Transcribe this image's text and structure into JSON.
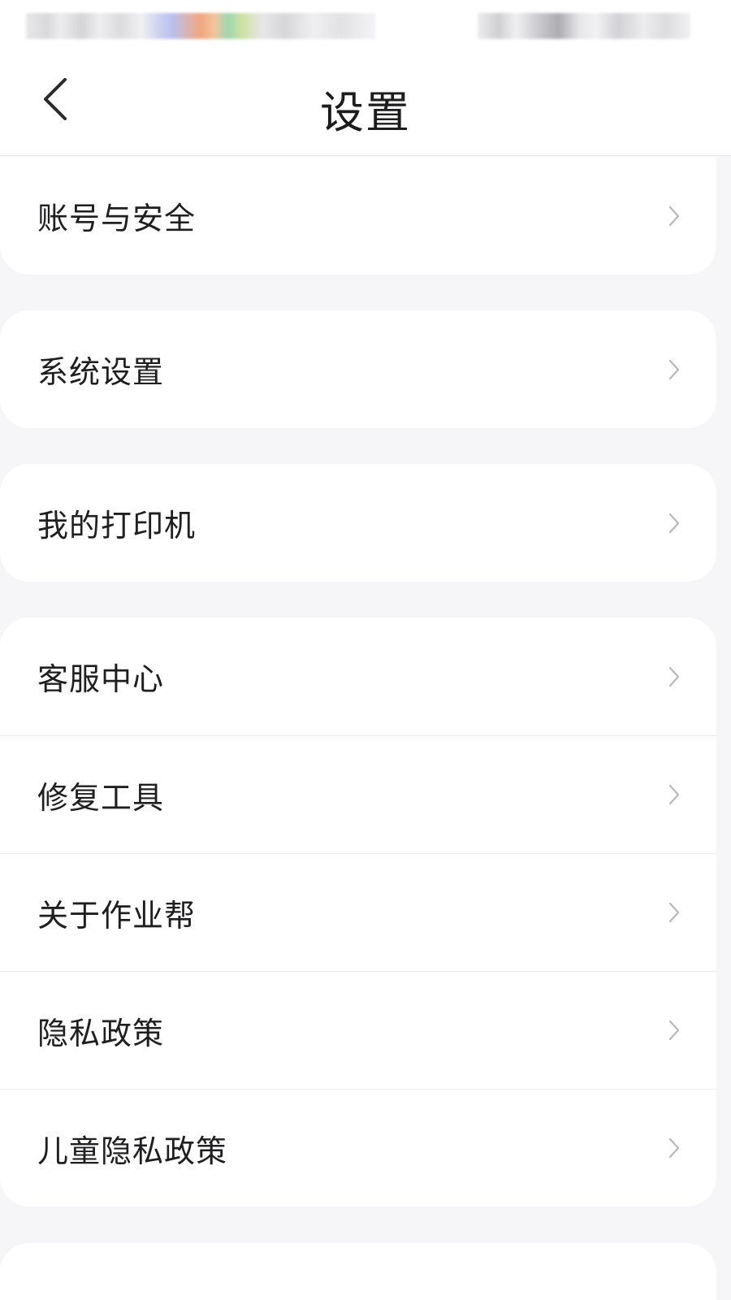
{
  "header": {
    "title": "设置",
    "back_icon": "back-arrow-icon"
  },
  "groups": [
    {
      "items": [
        {
          "label": "账号与安全",
          "icon": "chevron-right-icon"
        }
      ]
    },
    {
      "items": [
        {
          "label": "系统设置",
          "icon": "chevron-right-icon"
        }
      ]
    },
    {
      "items": [
        {
          "label": "我的打印机",
          "icon": "chevron-right-icon"
        }
      ]
    },
    {
      "items": [
        {
          "label": "客服中心",
          "icon": "chevron-right-icon"
        },
        {
          "label": "修复工具",
          "icon": "chevron-right-icon"
        },
        {
          "label": "关于作业帮",
          "icon": "chevron-right-icon"
        },
        {
          "label": "隐私政策",
          "icon": "chevron-right-icon"
        },
        {
          "label": "儿童隐私政策",
          "icon": "chevron-right-icon"
        }
      ]
    }
  ],
  "colors": {
    "background": "#f6f6f8",
    "card": "#ffffff",
    "text": "#1f1f21",
    "chevron": "#b8b8bd",
    "divider": "#ececef"
  }
}
